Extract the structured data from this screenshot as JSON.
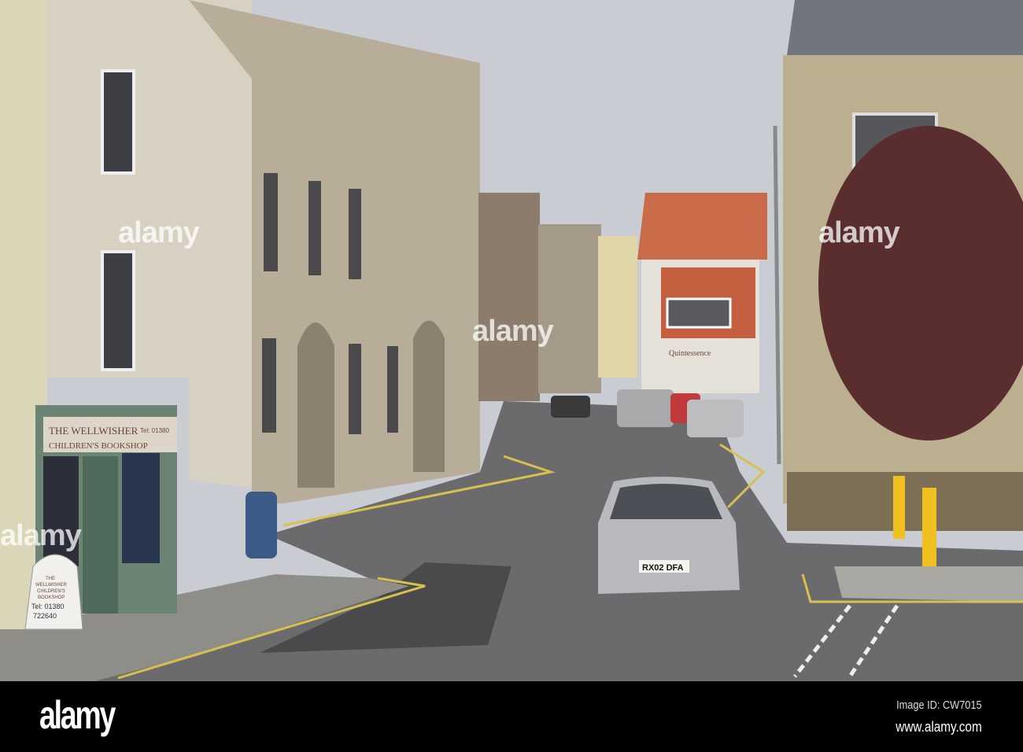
{
  "photo": {
    "shop_sign_line1": "THE WELLWISHER",
    "shop_sign_line2": "CHILDREN'S BOOKSHOP",
    "shop_sign_phone": "Tel: 01380",
    "board_line1": "THE",
    "board_line2": "WELLWISHER",
    "board_line3": "CHILDREN'S",
    "board_line4": "BOOKSHOP",
    "board_phone": "Tel: 01380",
    "board_phone2": "722640",
    "cafe_sign": "Quintessence",
    "license_plate": "RX02 DFA"
  },
  "watermark": {
    "text": "alamy"
  },
  "footer": {
    "logo": "alamy",
    "image_id": "Image ID: CW7015",
    "url": "www.alamy.com"
  }
}
